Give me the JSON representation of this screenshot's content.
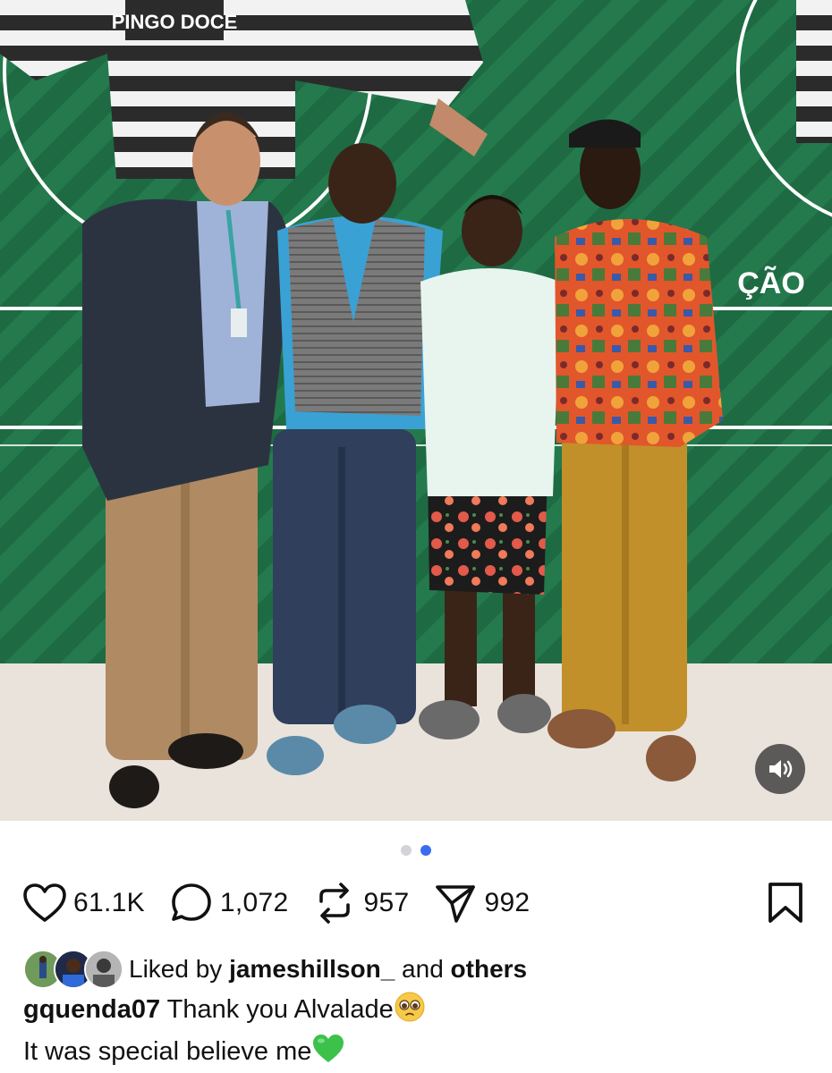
{
  "photo": {
    "description_icon": "photo",
    "sign_text_top": "PINGO DOCE",
    "sign_text_cao": "ÇÃO"
  },
  "media_controls": {
    "mute_icon": "speaker-icon"
  },
  "carousel": {
    "count": 2,
    "active_index": 1
  },
  "actions": {
    "likes": "61.1K",
    "comments": "1,072",
    "reposts": "957",
    "shares": "992"
  },
  "liked_by": {
    "prefix": "Liked by",
    "user": "jameshillson_",
    "middle": "and",
    "suffix": "others"
  },
  "caption": {
    "username": "gquenda07",
    "line1": "Thank you Alvalade",
    "line2": "It was special believe me"
  },
  "colors": {
    "active_dot": "#3b6cf0",
    "inactive_dot": "#d4d4d8",
    "wall_green": "#1f6b44",
    "heart_emoji": "#3cc24a"
  }
}
